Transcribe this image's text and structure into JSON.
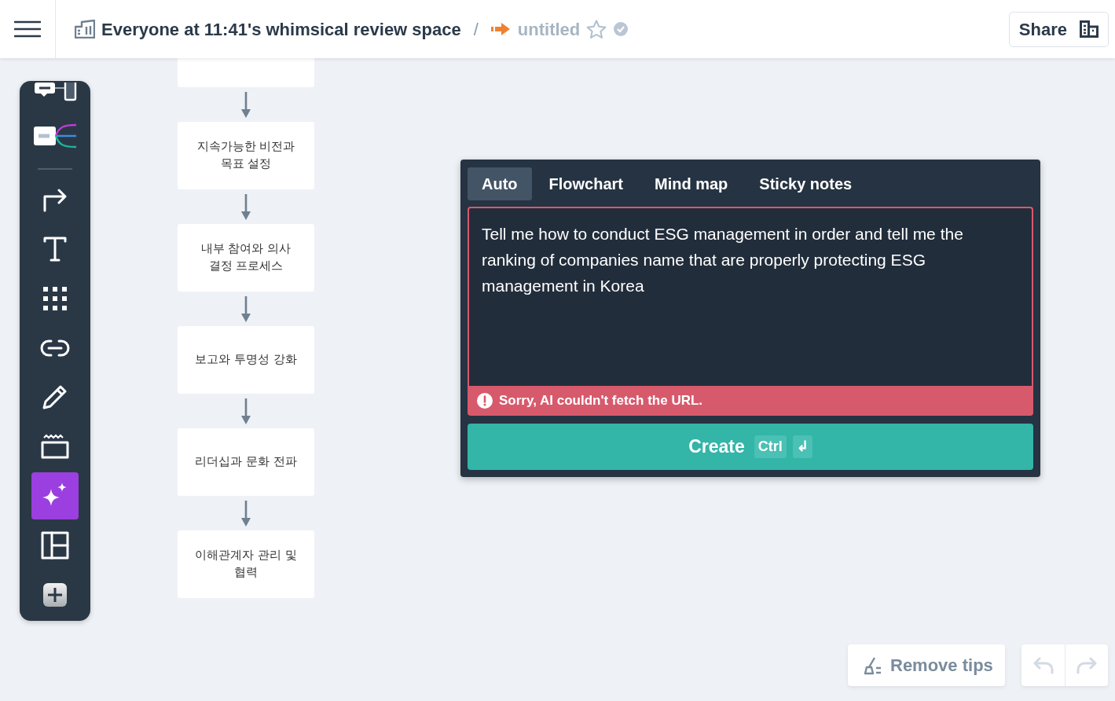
{
  "header": {
    "space_title": "Everyone at 11:41's whimsical review space",
    "separator": "/",
    "doc_title": "untitled",
    "starred": false,
    "share_label": "Share"
  },
  "toolbar": {
    "items": [
      {
        "kind": "sticky",
        "selected": false
      },
      {
        "kind": "mindmap",
        "selected": false
      },
      {
        "kind": "connector",
        "selected": false
      },
      {
        "kind": "text",
        "selected": false
      },
      {
        "kind": "grid",
        "selected": false
      },
      {
        "kind": "link",
        "selected": false
      },
      {
        "kind": "pen",
        "selected": false
      },
      {
        "kind": "frame",
        "selected": false
      },
      {
        "kind": "ai",
        "selected": true
      },
      {
        "kind": "layout",
        "selected": false
      },
      {
        "kind": "add",
        "selected": false
      }
    ]
  },
  "flowchart": {
    "cut_off_node": true,
    "nodes": [
      {
        "text": "지속가능한 비전과 목표 설정"
      },
      {
        "text": "내부 참여와 의사 결정 프로세스"
      },
      {
        "text": "보고와 투명성 강화"
      },
      {
        "text": "리더십과 문화 전파"
      },
      {
        "text": "이해관계자 관리 및 협력"
      }
    ]
  },
  "ai_dialog": {
    "tabs": [
      {
        "label": "Auto",
        "selected": true
      },
      {
        "label": "Flowchart",
        "selected": false
      },
      {
        "label": "Mind map",
        "selected": false
      },
      {
        "label": "Sticky notes",
        "selected": false
      }
    ],
    "prompt": "Tell me how to conduct ESG management in order and tell me the ranking of companies name that are properly protecting ESG management in Korea",
    "error": "Sorry, AI couldn't fetch the URL.",
    "create_label": "Create",
    "shortcut_keys": [
      "Ctrl",
      "↲"
    ]
  },
  "bottom_bar": {
    "remove_tips_label": "Remove tips",
    "undo": {
      "disabled": true
    },
    "redo": {
      "disabled": true
    }
  }
}
